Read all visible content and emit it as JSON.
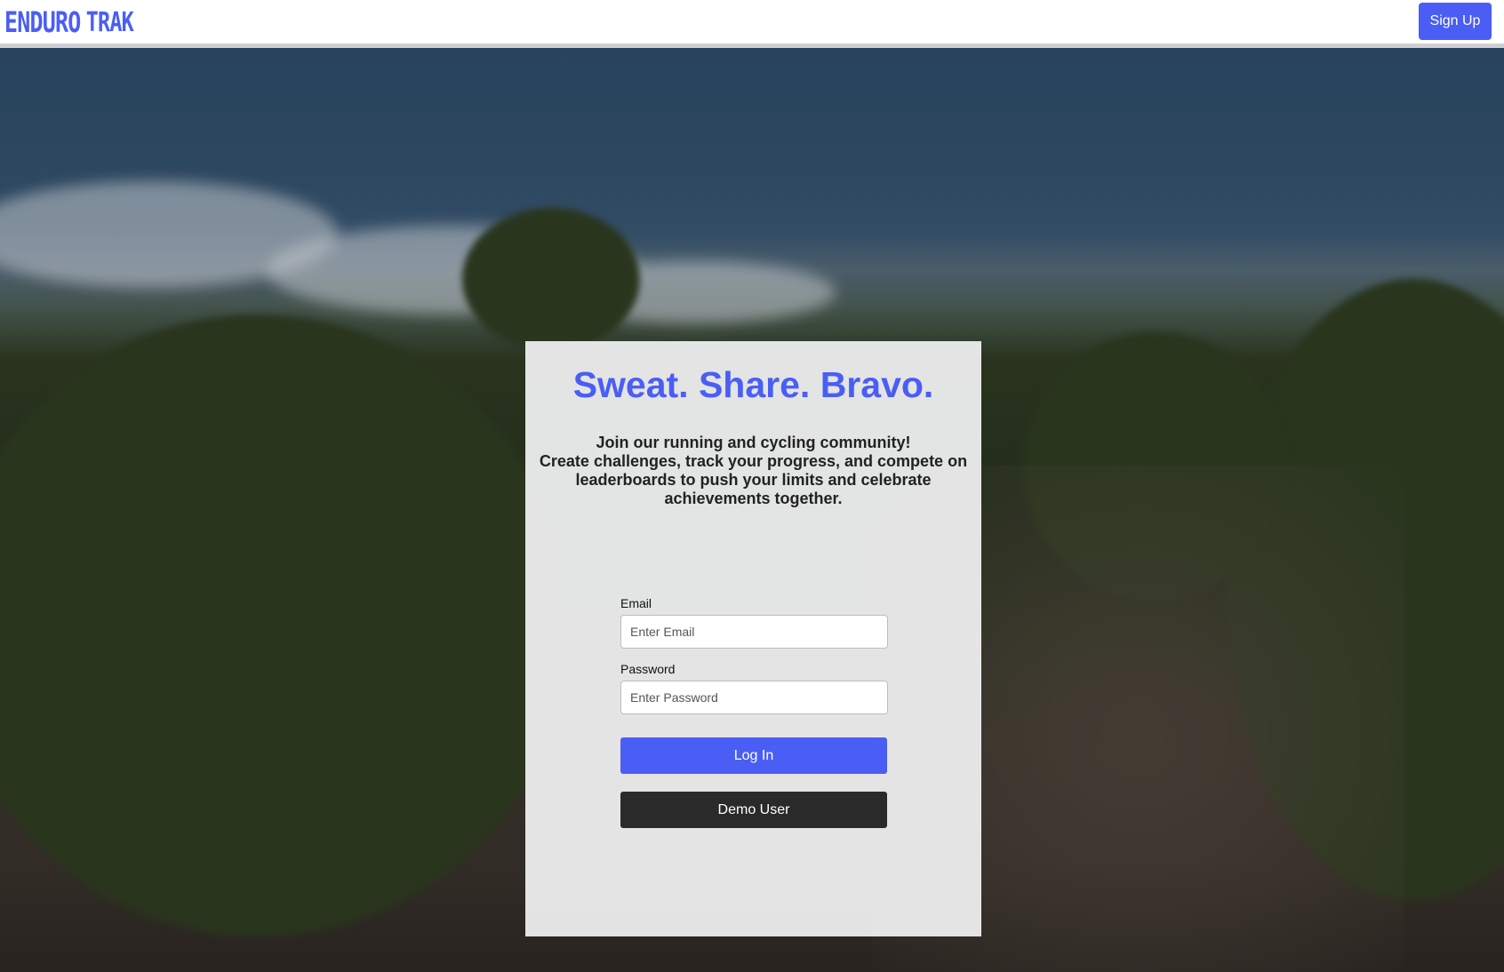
{
  "navbar": {
    "logo_word1": "ENDURO",
    "logo_word2": "TRAK",
    "signup_label": "Sign Up"
  },
  "login_card": {
    "title": "Sweat. Share. Bravo.",
    "tagline_line1": "Join our running and cycling community!",
    "tagline_rest": "Create challenges, track your progress, and compete on leaderboards to push your limits and celebrate achievements together.",
    "email_label": "Email",
    "email_placeholder": "Enter Email",
    "email_value": "",
    "password_label": "Password",
    "password_placeholder": "Enter Password",
    "password_value": "",
    "login_label": "Log In",
    "demo_label": "Demo User"
  },
  "colors": {
    "brand": "#4a5ef5",
    "demo_button": "#2a2a2a",
    "card_background": "#f2f2f3"
  }
}
